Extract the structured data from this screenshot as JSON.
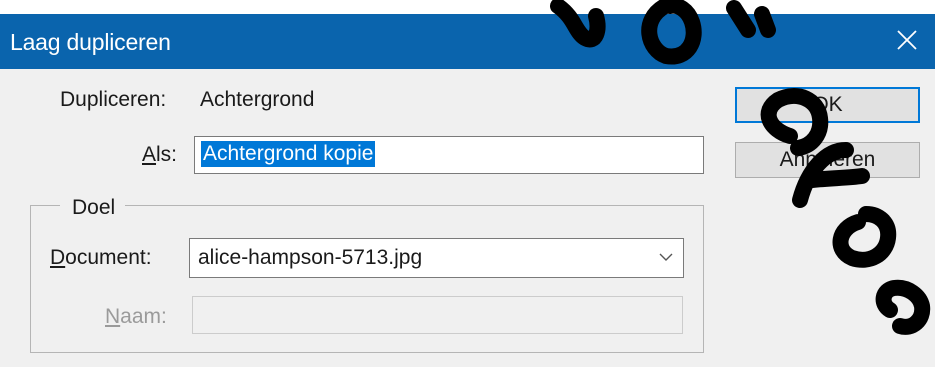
{
  "window": {
    "title": "Laag dupliceren",
    "close_icon": "close-icon"
  },
  "form": {
    "duplicate_label": "Dupliceren:",
    "duplicate_value": "Achtergrond",
    "as_label_access": "A",
    "as_label_rest": "ls:",
    "as_value": "Achtergrond kopie"
  },
  "destination": {
    "legend": "Doel",
    "document_label_access": "D",
    "document_label_rest": "ocument:",
    "document_value": "alice-hampson-5713.jpg",
    "name_label_access": "N",
    "name_label_rest": "aam:",
    "name_value": ""
  },
  "buttons": {
    "ok": "OK",
    "cancel": "Annuleren"
  },
  "colors": {
    "titlebar": "#0a64ad",
    "selection": "#0078d7",
    "dialog": "#f0f0f0"
  }
}
